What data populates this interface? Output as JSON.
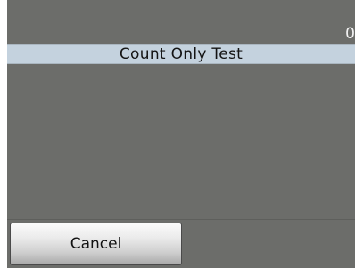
{
  "counter": {
    "value": "0"
  },
  "header": {
    "title": "Count Only Test"
  },
  "footer": {
    "cancel_label": "Cancel"
  },
  "colors": {
    "background": "#6c6d6a",
    "title_bar": "#c4d2de"
  }
}
